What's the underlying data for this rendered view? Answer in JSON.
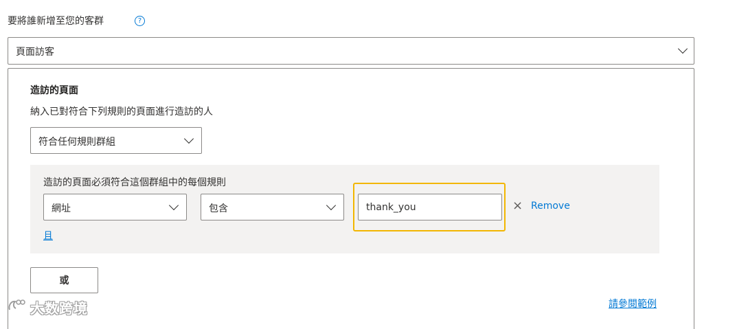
{
  "header": {
    "label": "要將誰新增至您的客群",
    "help_icon": "question-circle-icon",
    "help_glyph": "?"
  },
  "audience_select": {
    "value": "頁面訪客"
  },
  "section": {
    "title": "造訪的頁面",
    "description": "納入已對符合下列規則的頁面進行造訪的人",
    "match_select": {
      "value": "符合任何規則群組"
    }
  },
  "rule_group": {
    "title": "造訪的頁面必須符合這個群組中的每個規則",
    "rules": [
      {
        "field": "網址",
        "operator": "包含",
        "value": "thank_you",
        "remove_label": "Remove",
        "remove_glyph": "×"
      }
    ],
    "and_link": "且"
  },
  "or_button": "或",
  "example_link": "請參閱範例",
  "watermark": {
    "text": "大数跨境"
  },
  "colors": {
    "accent": "#0078d4",
    "highlight": "#f2b600",
    "group_bg": "#f3f2f1",
    "border": "#8a8886"
  }
}
